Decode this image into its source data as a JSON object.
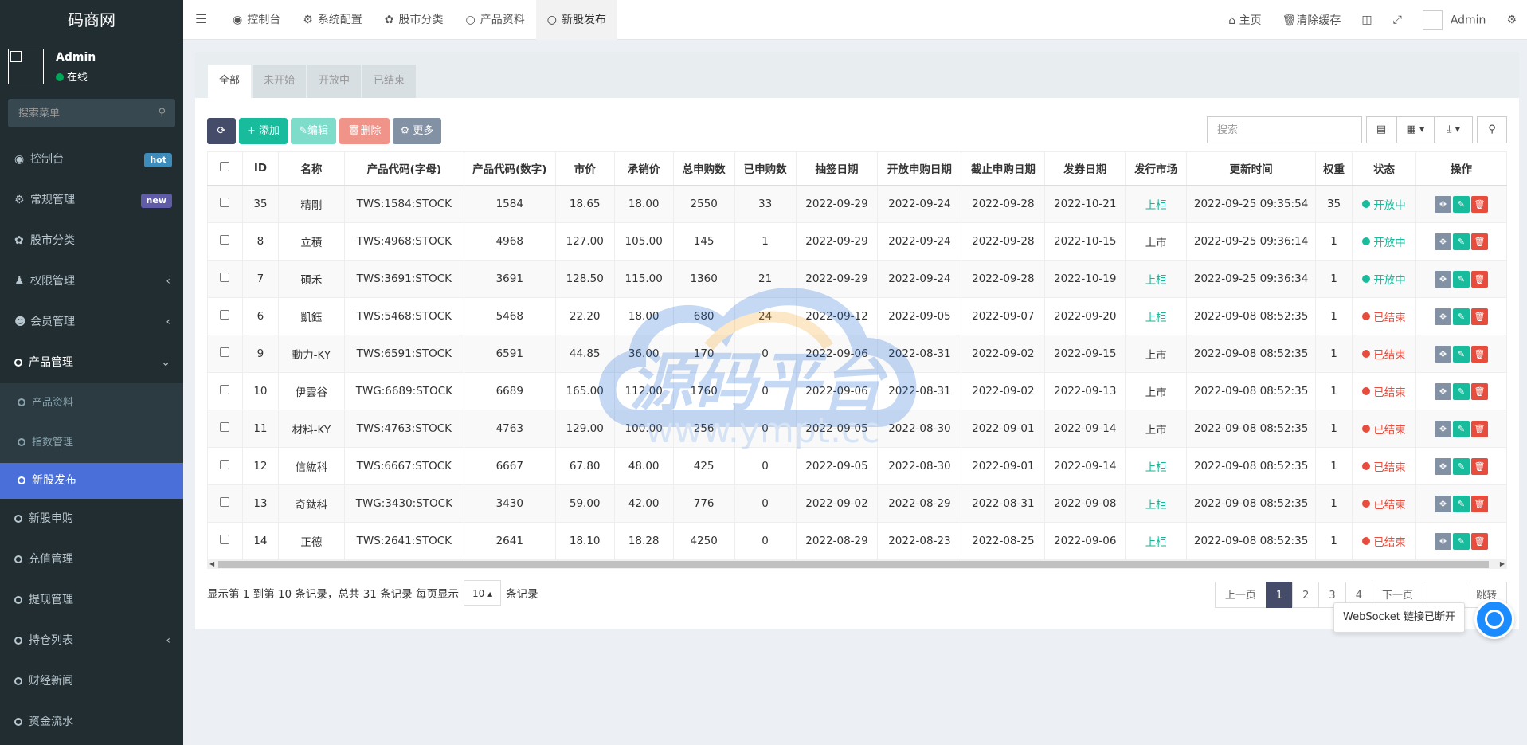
{
  "brand": "码商网",
  "user": {
    "name": "Admin",
    "status": "在线"
  },
  "sidebar_search_placeholder": "搜索菜单",
  "menu": [
    {
      "label": "控制台",
      "icon": "dashboard-icon",
      "badge": "hot"
    },
    {
      "label": "常规管理",
      "icon": "cogs-icon",
      "badge": "new"
    },
    {
      "label": "股市分类",
      "icon": "leaf-icon"
    },
    {
      "label": "权限管理",
      "icon": "group-icon"
    },
    {
      "label": "会员管理",
      "icon": "user-circle-icon"
    },
    {
      "label": "产品管理",
      "icon": "circle-icon"
    }
  ],
  "submenu": [
    "产品资料",
    "指数管理",
    "新股发布"
  ],
  "menu_after": [
    "新股申购",
    "充值管理",
    "提现管理",
    "持仓列表",
    "财经新闻",
    "资金流水"
  ],
  "topnav": {
    "tabs": [
      "控制台",
      "系统配置",
      "股市分类",
      "产品资料",
      "新股发布"
    ],
    "home": "主页",
    "clear_cache": "清除缓存",
    "admin": "Admin"
  },
  "filter_tabs": [
    "全部",
    "未开始",
    "开放中",
    "已结束"
  ],
  "toolbar": {
    "add": "添加",
    "edit": "编辑",
    "delete": "删除",
    "more": "更多",
    "search_placeholder": "搜索"
  },
  "columns": [
    "ID",
    "名称",
    "产品代码(字母)",
    "产品代码(数字)",
    "市价",
    "承销价",
    "总申购数",
    "已申购数",
    "抽签日期",
    "开放申购日期",
    "截止申购日期",
    "发券日期",
    "发行市场",
    "更新时间",
    "权重",
    "状态",
    "操作"
  ],
  "rows": [
    [
      "35",
      "精剛",
      "TWS:1584:STOCK",
      "1584",
      "18.65",
      "18.00",
      "2550",
      "33",
      "2022-09-29",
      "2022-09-24",
      "2022-09-28",
      "2022-10-21",
      "上柜",
      "2022-09-25 09:35:54",
      "35",
      "开放中"
    ],
    [
      "8",
      "立積",
      "TWS:4968:STOCK",
      "4968",
      "127.00",
      "105.00",
      "145",
      "1",
      "2022-09-29",
      "2022-09-24",
      "2022-09-28",
      "2022-10-15",
      "上市",
      "2022-09-25 09:36:14",
      "1",
      "开放中"
    ],
    [
      "7",
      "碩禾",
      "TWS:3691:STOCK",
      "3691",
      "128.50",
      "115.00",
      "1360",
      "21",
      "2022-09-29",
      "2022-09-24",
      "2022-09-28",
      "2022-10-19",
      "上柜",
      "2022-09-25 09:36:34",
      "1",
      "开放中"
    ],
    [
      "6",
      "凱鈺",
      "TWS:5468:STOCK",
      "5468",
      "22.20",
      "18.00",
      "680",
      "24",
      "2022-09-12",
      "2022-09-05",
      "2022-09-07",
      "2022-09-20",
      "上柜",
      "2022-09-08 08:52:35",
      "1",
      "已结束"
    ],
    [
      "9",
      "動力-KY",
      "TWS:6591:STOCK",
      "6591",
      "44.85",
      "36.00",
      "170",
      "0",
      "2022-09-06",
      "2022-08-31",
      "2022-09-02",
      "2022-09-15",
      "上市",
      "2022-09-08 08:52:35",
      "1",
      "已结束"
    ],
    [
      "10",
      "伊雲谷",
      "TWG:6689:STOCK",
      "6689",
      "165.00",
      "112.00",
      "1760",
      "0",
      "2022-09-06",
      "2022-08-31",
      "2022-09-02",
      "2022-09-13",
      "上市",
      "2022-09-08 08:52:35",
      "1",
      "已结束"
    ],
    [
      "11",
      "材料-KY",
      "TWS:4763:STOCK",
      "4763",
      "129.00",
      "100.00",
      "256",
      "0",
      "2022-09-05",
      "2022-08-30",
      "2022-09-01",
      "2022-09-14",
      "上市",
      "2022-09-08 08:52:35",
      "1",
      "已结束"
    ],
    [
      "12",
      "信紘科",
      "TWS:6667:STOCK",
      "6667",
      "67.80",
      "48.00",
      "425",
      "0",
      "2022-09-05",
      "2022-08-30",
      "2022-09-01",
      "2022-09-14",
      "上柜",
      "2022-09-08 08:52:35",
      "1",
      "已结束"
    ],
    [
      "13",
      "奇鈦科",
      "TWG:3430:STOCK",
      "3430",
      "59.00",
      "42.00",
      "776",
      "0",
      "2022-09-02",
      "2022-08-29",
      "2022-08-31",
      "2022-09-08",
      "上柜",
      "2022-09-08 08:52:35",
      "1",
      "已结束"
    ],
    [
      "14",
      "正德",
      "TWS:2641:STOCK",
      "2641",
      "18.10",
      "18.28",
      "4250",
      "0",
      "2022-08-29",
      "2022-08-23",
      "2022-08-25",
      "2022-09-06",
      "上柜",
      "2022-09-08 08:52:35",
      "1",
      "已结束"
    ]
  ],
  "pagination": {
    "info": "显示第 1 到第 10 条记录，总共 31 条记录 每页显示",
    "page_size": "10",
    "records": "条记录",
    "prev": "上一页",
    "pages": [
      "1",
      "2",
      "3",
      "4"
    ],
    "next": "下一页",
    "jump": "跳转"
  },
  "toast": "WebSocket 链接已断开",
  "watermark": {
    "title": "源码平台",
    "url": "www.ympt.cc"
  },
  "colors": {
    "sidebar": "#222d32",
    "selected": "#4a6fd8",
    "green": "#18bc9c",
    "red": "#e74c3c"
  }
}
